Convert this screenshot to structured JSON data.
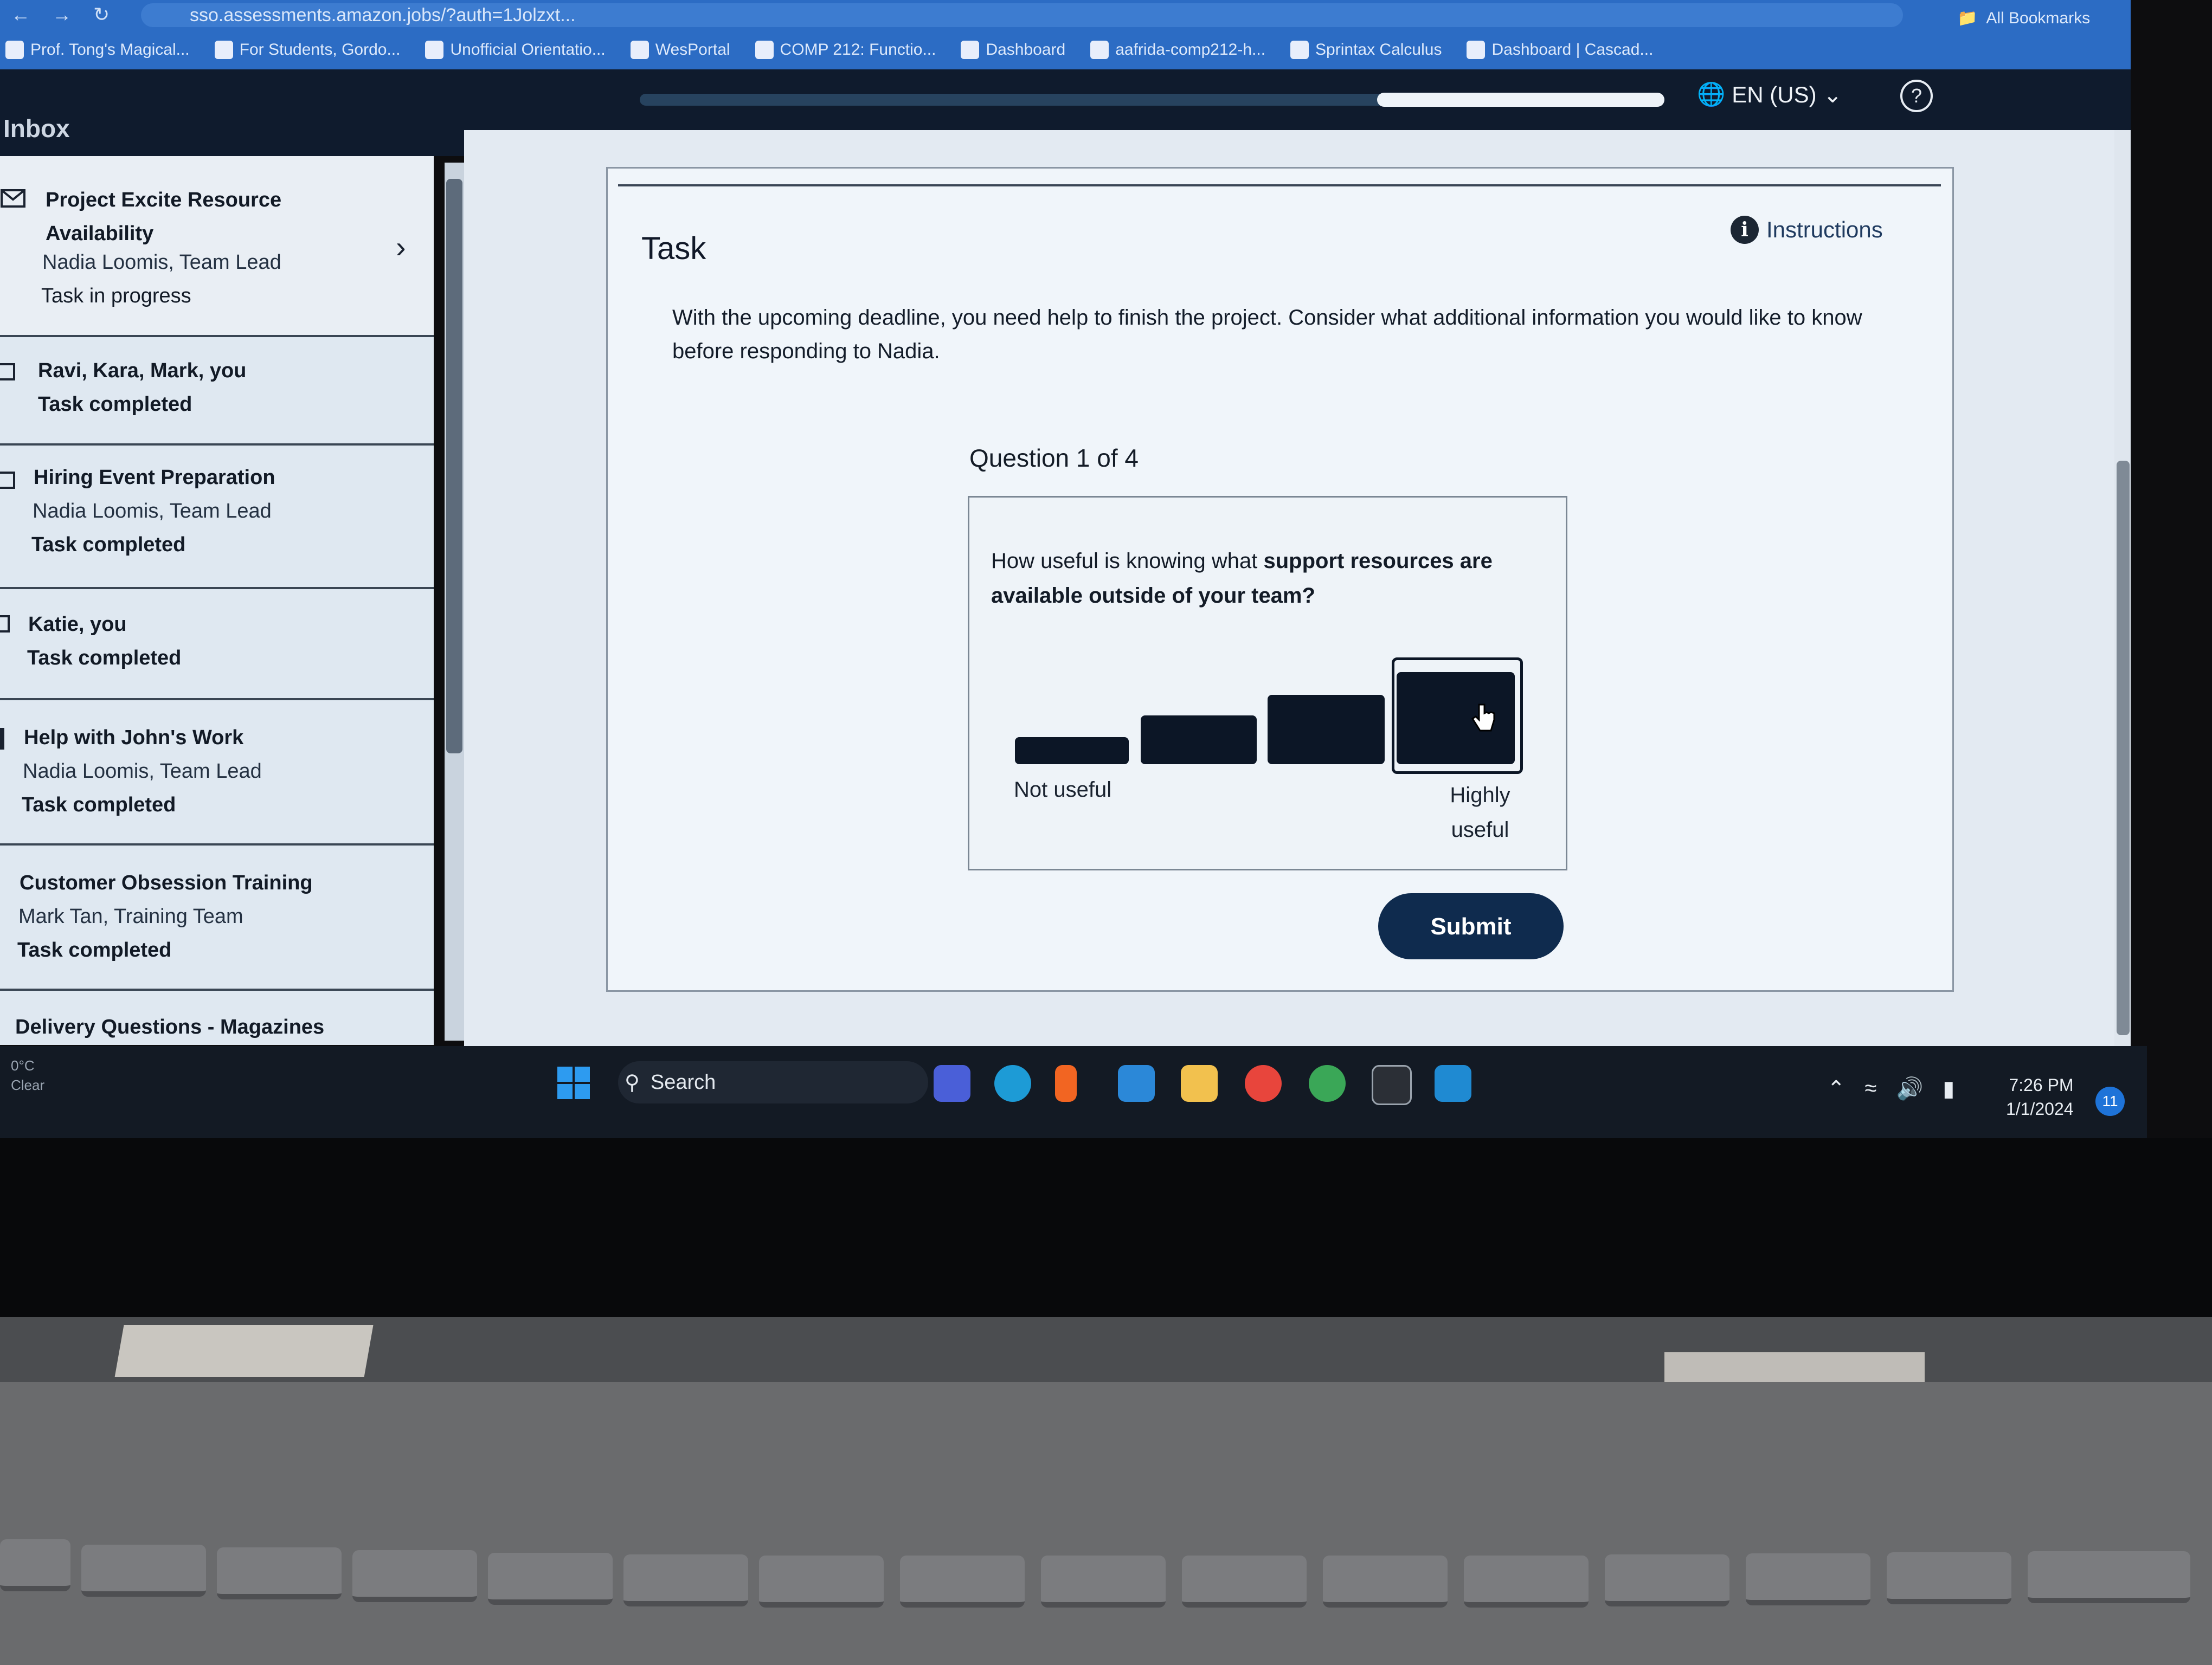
{
  "browser": {
    "url": "sso.assessments.amazon.jobs/?auth=1Jolzxt...",
    "bookmarks": [
      "Prof. Tong's Magical...",
      "For Students, Gordo...",
      "Unofficial Orientatio...",
      "WesPortal",
      "COMP 212: Functio...",
      "Dashboard",
      "aafrida-comp212-h...",
      "Sprintax Calculus",
      "Dashboard | Cascad..."
    ],
    "all_bookmarks": "All Bookmarks"
  },
  "header": {
    "inbox_title": "Inbox",
    "progress": 0.28,
    "language": "EN (US)"
  },
  "sidebar": {
    "items": [
      {
        "title": "Project Excite Resource Availability",
        "sub": "Nadia Loomis, Team Lead",
        "status": "Task in progress"
      },
      {
        "title": "Ravi, Kara, Mark, you",
        "sub": "",
        "status": "Task completed"
      },
      {
        "title": "Hiring Event Preparation",
        "sub": "Nadia Loomis, Team Lead",
        "status": "Task completed"
      },
      {
        "title": "Katie, you",
        "sub": "",
        "status": "Task completed"
      },
      {
        "title": "Help with John's Work",
        "sub": "Nadia Loomis, Team Lead",
        "status": "Task completed"
      },
      {
        "title": "Customer Obsession Training",
        "sub": "Mark Tan, Training Team",
        "status": "Task completed"
      },
      {
        "title": "Delivery Questions - Magazines",
        "sub": "",
        "status": ""
      }
    ]
  },
  "task": {
    "title": "Task",
    "instructions_label": "Instructions",
    "text": "With the upcoming deadline, you need help to finish the project. Consider what additional information you would like to know before responding to Nadia.",
    "question_count": "Question 1 of 4",
    "question_prefix": "How useful is knowing what ",
    "question_bold": "support resources are available outside of your team?",
    "scale_left": "Not useful",
    "scale_right": "Highly useful",
    "selected_rating": 4,
    "rating_options": 4,
    "submit_label": "Submit"
  },
  "taskbar": {
    "weather_temp": "0°C",
    "weather_desc": "Clear",
    "search_label": "Search",
    "time": "7:26 PM",
    "date": "1/1/2024",
    "notifications": "11"
  }
}
